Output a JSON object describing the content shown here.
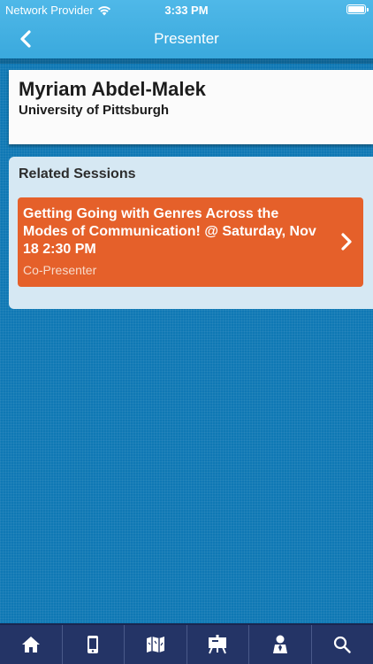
{
  "status_bar": {
    "carrier": "Network Provider",
    "time": "3:33 PM",
    "battery_level": 1.0
  },
  "nav": {
    "title": "Presenter",
    "back_icon": "chevron-left-icon"
  },
  "presenter": {
    "name": "Myriam Abdel-Malek",
    "organization": "University of Pittsburgh"
  },
  "related_sessions": {
    "heading": "Related Sessions",
    "items": [
      {
        "title": "Getting Going with Genres Across the Modes of Communication! @ Saturday, Nov 18 2:30 PM",
        "role": "Co-Presenter",
        "icon": "chevron-right-icon"
      }
    ]
  },
  "tabs": [
    {
      "icon": "home-icon"
    },
    {
      "icon": "mobile-phone-icon"
    },
    {
      "icon": "map-icon"
    },
    {
      "icon": "presentation-board-icon"
    },
    {
      "icon": "person-icon"
    },
    {
      "icon": "search-icon"
    }
  ],
  "colors": {
    "header": "#3aa9dd",
    "background": "#0f78b4",
    "session_accent": "#e5602a",
    "tabbar": "#243466"
  }
}
